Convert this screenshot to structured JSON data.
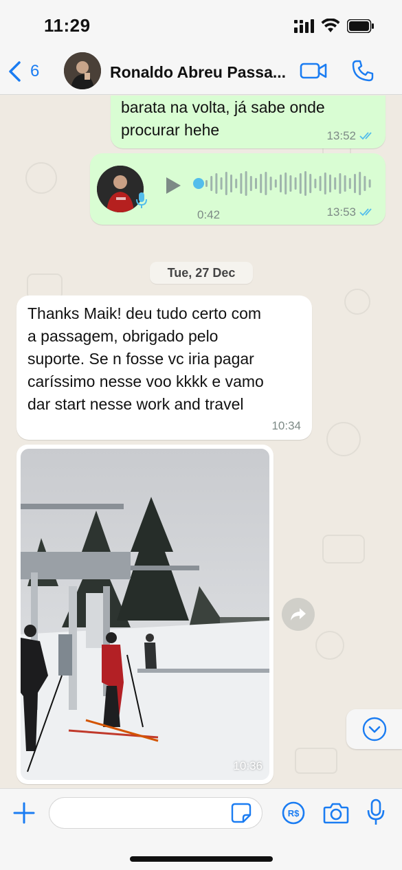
{
  "status_bar": {
    "time": "11:29"
  },
  "header": {
    "back_count": "6",
    "contact_name": "Ronaldo Abreu Passa..."
  },
  "messages": {
    "m1": {
      "text": "barata na volta, já sabe onde\nprocurar hehe",
      "time": "13:52"
    },
    "voice": {
      "duration": "0:42",
      "time": "13:53",
      "progress": 0
    },
    "date_separator": "Tue, 27 Dec",
    "m2": {
      "text": "Thanks Maik! deu tudo certo com\na passagem, obrigado pelo\nsuporte. Se n fosse vc iria pagar\ncaríssimo nesse voo kkkk  e vamo\ndar start nesse work and travel",
      "time": "10:34"
    },
    "photo": {
      "time": "10:36"
    }
  },
  "input": {
    "value": "",
    "placeholder": ""
  },
  "colors": {
    "accent": "#1a7cf2",
    "outgoing_bubble": "#d9fdd3",
    "incoming_bubble": "#ffffff",
    "chat_background": "#efeae2",
    "read_ticks": "#53bdeb"
  },
  "icons": [
    "back-chevron-icon",
    "video-call-icon",
    "phone-icon",
    "play-icon",
    "mic-icon",
    "double-check-icon",
    "forward-icon",
    "chevron-down-icon",
    "plus-icon",
    "sticker-icon",
    "payment-icon",
    "camera-icon"
  ]
}
